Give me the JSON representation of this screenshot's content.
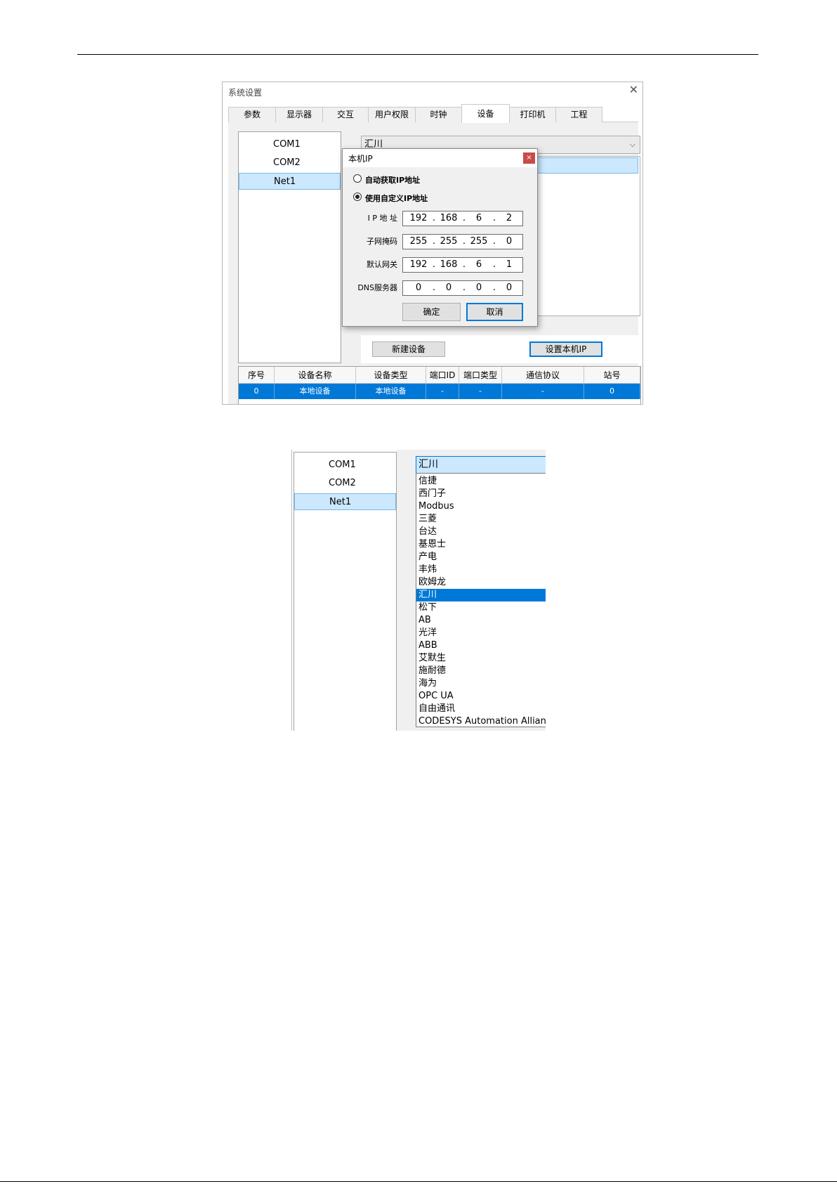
{
  "window": {
    "title": "系统设置",
    "close_glyph": "✕",
    "tabs": [
      {
        "label": "参数"
      },
      {
        "label": "显示器"
      },
      {
        "label": "交互"
      },
      {
        "label": "用户权限"
      },
      {
        "label": "时钟"
      },
      {
        "label": "设备",
        "active": true
      },
      {
        "label": "打印机"
      },
      {
        "label": "工程"
      }
    ]
  },
  "ports": [
    {
      "label": "COM1",
      "selected": false
    },
    {
      "label": "COM2",
      "selected": false
    },
    {
      "label": "Net1",
      "selected": true
    }
  ],
  "brand_combo": {
    "value": "汇川",
    "arrow": "⌵"
  },
  "buttons": {
    "new_device": "新建设备",
    "set_local_ip": "设置本机IP"
  },
  "device_table": {
    "headers": [
      "序号",
      "设备名称",
      "设备类型",
      "端口ID",
      "端口类型",
      "通信协议",
      "站号"
    ],
    "rows": [
      [
        "0",
        "本地设备",
        "本地设备",
        "-",
        "-",
        "-",
        "0"
      ]
    ]
  },
  "ip_dialog": {
    "title": "本机IP",
    "close_glyph": "×",
    "option_auto": "自动获取IP地址",
    "option_custom": "使用自定义IP地址",
    "selected_option": "custom",
    "fields": [
      {
        "label": "I P 地 址",
        "octets": [
          "192",
          "168",
          "6",
          "2"
        ]
      },
      {
        "label": "子网掩码",
        "octets": [
          "255",
          "255",
          "255",
          "0"
        ]
      },
      {
        "label": "默认网关",
        "octets": [
          "192",
          "168",
          "6",
          "1"
        ]
      },
      {
        "label": "DNS服务器",
        "octets": [
          "0",
          "0",
          "0",
          "0"
        ]
      }
    ],
    "ok_label": "确定",
    "cancel_label": "取消"
  },
  "dropdown": {
    "current": "汇川",
    "options": [
      "信捷",
      "西门子",
      "Modbus",
      "三菱",
      "台达",
      "基恩士",
      "产电",
      "丰炜",
      "欧姆龙",
      "汇川",
      "松下",
      "AB",
      "光洋",
      "ABB",
      "艾默生",
      "施耐德",
      "海为",
      "OPC UA",
      "自由通讯",
      "CODESYS Automation Alliance"
    ],
    "selected": "汇川"
  }
}
